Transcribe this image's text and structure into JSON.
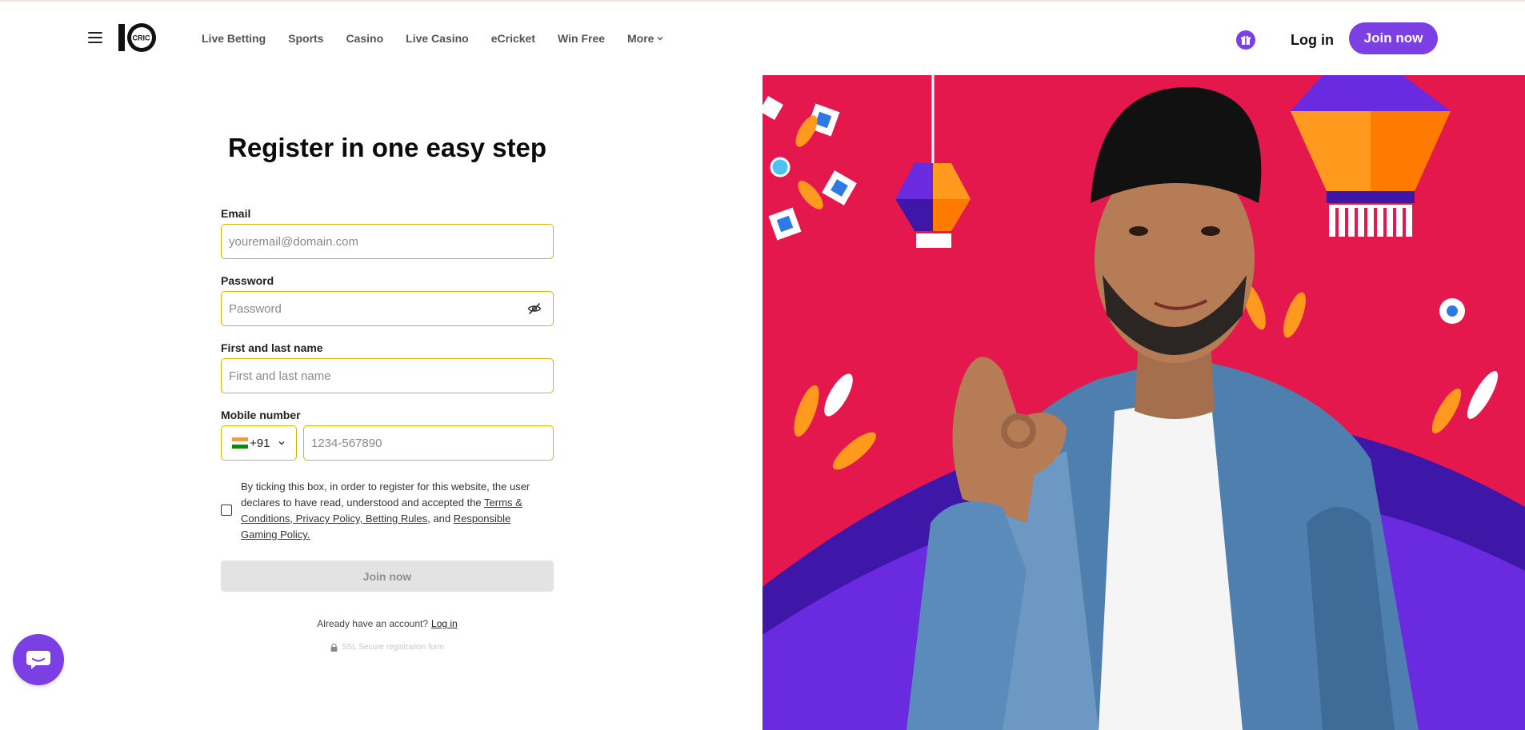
{
  "header": {
    "logo_text": "CRIC",
    "nav": [
      "Live Betting",
      "Sports",
      "Casino",
      "Live Casino",
      "eCricket",
      "Win Free",
      "More"
    ],
    "login_label": "Log in",
    "join_label": "Join now"
  },
  "form": {
    "title": "Register in one easy step",
    "email": {
      "label": "Email",
      "placeholder": "youremail@domain.com",
      "value": ""
    },
    "password": {
      "label": "Password",
      "placeholder": "Password",
      "value": ""
    },
    "name": {
      "label": "First and last name",
      "placeholder": "First and last name",
      "value": ""
    },
    "mobile": {
      "label": "Mobile number",
      "country_code": "+91",
      "placeholder": "1234-567890",
      "value": ""
    },
    "consent": {
      "text": "By ticking this box, in order to register for this website, the user declares to have read, understood and accepted the",
      "links": "Terms & Conditions, Privacy Policy, Betting Rules,",
      "and": "and",
      "link2": "Responsible Gaming Policy.",
      "checked": false
    },
    "submit_label": "Join now",
    "already_text": "Already have an account?",
    "login_link": "Log in",
    "ssl_text": "SSL Secure registration form"
  },
  "colors": {
    "accent": "#7b3fe4",
    "field_border": "#d9b400",
    "hero_bg": "#e5184e"
  },
  "icons": [
    "hamburger-icon",
    "gift-icon",
    "chevron-down-icon",
    "eye-off-icon",
    "lock-icon",
    "chat-icon",
    "india-flag-icon"
  ]
}
